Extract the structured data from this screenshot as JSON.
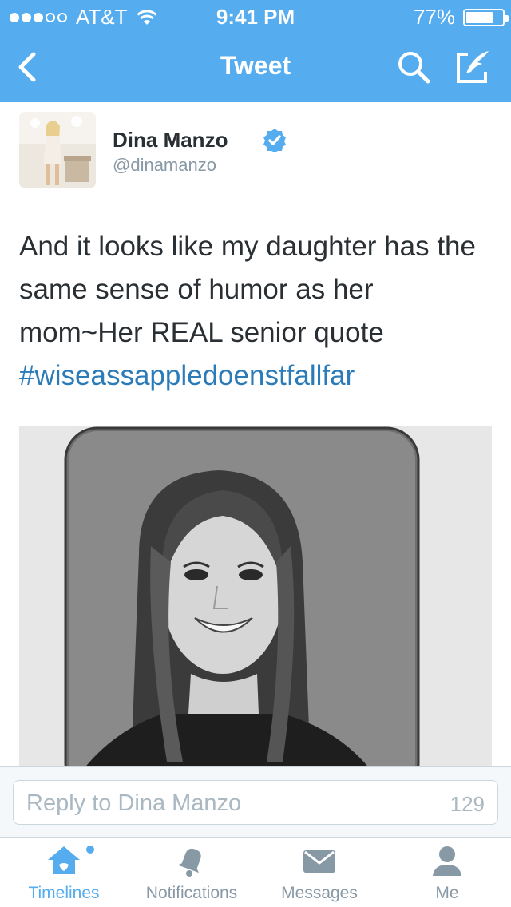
{
  "status_bar": {
    "carrier": "AT&T",
    "signal_bars_filled": 3,
    "signal_bars_total": 5,
    "time": "9:41 PM",
    "battery_percent": "77%",
    "battery_level": 0.77
  },
  "nav": {
    "title": "Tweet",
    "back_icon": "chevron-left-icon",
    "search_icon": "search-icon",
    "compose_icon": "compose-icon"
  },
  "tweet": {
    "author_name": "Dina Manzo",
    "author_handle": "@dinamanzo",
    "verified": true,
    "text": "And it looks like my daughter has the same sense of humor as her mom~Her REAL senior quote ",
    "hashtag": "#wiseassappledoenstfallfar"
  },
  "reply": {
    "placeholder": "Reply to Dina Manzo",
    "char_count": "129"
  },
  "tabs": [
    {
      "label": "Timelines",
      "icon": "home-icon",
      "active": true
    },
    {
      "label": "Notifications",
      "icon": "bell-icon",
      "active": false
    },
    {
      "label": "Messages",
      "icon": "envelope-icon",
      "active": false
    },
    {
      "label": "Me",
      "icon": "person-icon",
      "active": false
    }
  ],
  "colors": {
    "brand": "#55acee",
    "link": "#2b7bb9",
    "muted": "#8899a6",
    "text": "#292f33"
  }
}
